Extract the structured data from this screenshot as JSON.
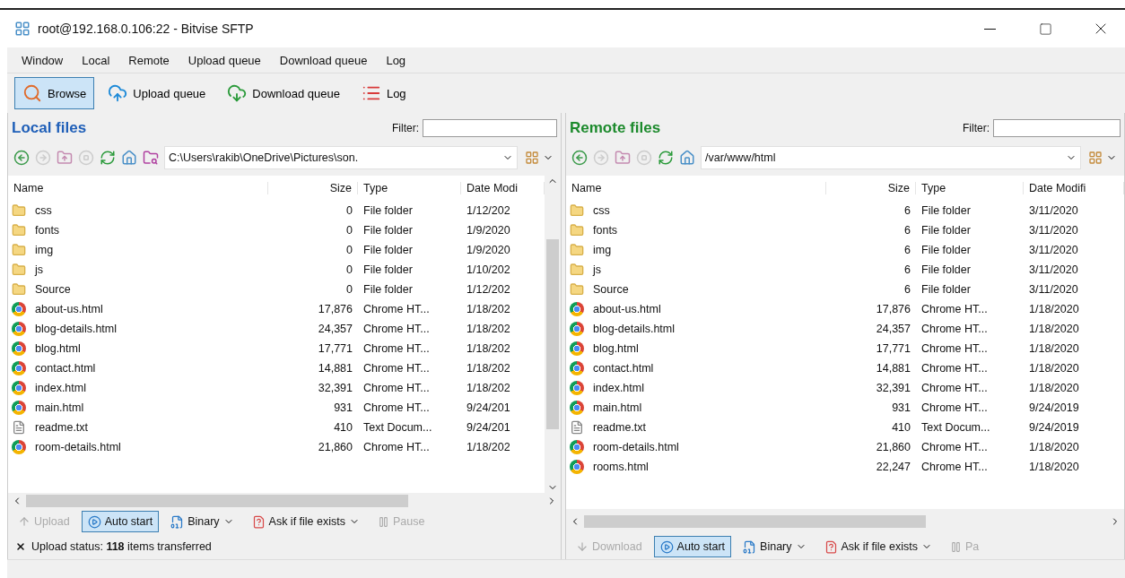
{
  "window": {
    "title": "root@192.168.0.106:22 - Bitvise SFTP"
  },
  "menu": [
    "Window",
    "Local",
    "Remote",
    "Upload queue",
    "Download queue",
    "Log"
  ],
  "toolbar": [
    {
      "label": "Browse",
      "kind": "browse",
      "selected": true
    },
    {
      "label": "Upload queue",
      "kind": "upload",
      "selected": false
    },
    {
      "label": "Download queue",
      "kind": "download",
      "selected": false
    },
    {
      "label": "Log",
      "kind": "log",
      "selected": false
    }
  ],
  "panes": [
    {
      "kind": "local",
      "title": "Local files",
      "color": "#1f5fb8",
      "filter_label": "Filter:",
      "path": "C:\\Users\\rakib\\OneDrive\\Pictures\\son.",
      "columns": [
        "Name",
        "Size",
        "Type",
        "Date Modi"
      ],
      "rows": [
        {
          "kind": "folder",
          "name": "css",
          "size": "0",
          "type": "File folder",
          "date": "1/12/202"
        },
        {
          "kind": "folder",
          "name": "fonts",
          "size": "0",
          "type": "File folder",
          "date": "1/9/2020"
        },
        {
          "kind": "folder",
          "name": "img",
          "size": "0",
          "type": "File folder",
          "date": "1/9/2020"
        },
        {
          "kind": "folder",
          "name": "js",
          "size": "0",
          "type": "File folder",
          "date": "1/10/202"
        },
        {
          "kind": "folder",
          "name": "Source",
          "size": "0",
          "type": "File folder",
          "date": "1/12/202"
        },
        {
          "kind": "html",
          "name": "about-us.html",
          "size": "17,876",
          "type": "Chrome HT...",
          "date": "1/18/202"
        },
        {
          "kind": "html",
          "name": "blog-details.html",
          "size": "24,357",
          "type": "Chrome HT...",
          "date": "1/18/202"
        },
        {
          "kind": "html",
          "name": "blog.html",
          "size": "17,771",
          "type": "Chrome HT...",
          "date": "1/18/202"
        },
        {
          "kind": "html",
          "name": "contact.html",
          "size": "14,881",
          "type": "Chrome HT...",
          "date": "1/18/202"
        },
        {
          "kind": "html",
          "name": "index.html",
          "size": "32,391",
          "type": "Chrome HT...",
          "date": "1/18/202"
        },
        {
          "kind": "html",
          "name": "main.html",
          "size": "931",
          "type": "Chrome HT...",
          "date": "9/24/201"
        },
        {
          "kind": "text",
          "name": "readme.txt",
          "size": "410",
          "type": "Text Docum...",
          "date": "9/24/201"
        },
        {
          "kind": "html",
          "name": "room-details.html",
          "size": "21,860",
          "type": "Chrome HT...",
          "date": "1/18/202"
        }
      ],
      "transfer": {
        "label": "Upload",
        "disabled": true
      },
      "auto_start": {
        "label": "Auto start",
        "selected": true
      },
      "mode": "Binary",
      "exists": "Ask if file exists",
      "pause": {
        "label": "Pause",
        "disabled": true
      },
      "status": "Upload status: **118** items transferred"
    },
    {
      "kind": "remote",
      "title": "Remote files",
      "color": "#1c8a2c",
      "filter_label": "Filter:",
      "path": "/var/www/html",
      "columns": [
        "Name",
        "Size",
        "Type",
        "Date Modifi"
      ],
      "rows": [
        {
          "kind": "folder",
          "name": "css",
          "size": "6",
          "type": "File folder",
          "date": "3/11/2020"
        },
        {
          "kind": "folder",
          "name": "fonts",
          "size": "6",
          "type": "File folder",
          "date": "3/11/2020"
        },
        {
          "kind": "folder",
          "name": "img",
          "size": "6",
          "type": "File folder",
          "date": "3/11/2020"
        },
        {
          "kind": "folder",
          "name": "js",
          "size": "6",
          "type": "File folder",
          "date": "3/11/2020"
        },
        {
          "kind": "folder",
          "name": "Source",
          "size": "6",
          "type": "File folder",
          "date": "3/11/2020"
        },
        {
          "kind": "html",
          "name": "about-us.html",
          "size": "17,876",
          "type": "Chrome HT...",
          "date": "1/18/2020"
        },
        {
          "kind": "html",
          "name": "blog-details.html",
          "size": "24,357",
          "type": "Chrome HT...",
          "date": "1/18/2020"
        },
        {
          "kind": "html",
          "name": "blog.html",
          "size": "17,771",
          "type": "Chrome HT...",
          "date": "1/18/2020"
        },
        {
          "kind": "html",
          "name": "contact.html",
          "size": "14,881",
          "type": "Chrome HT...",
          "date": "1/18/2020"
        },
        {
          "kind": "html",
          "name": "index.html",
          "size": "32,391",
          "type": "Chrome HT...",
          "date": "1/18/2020"
        },
        {
          "kind": "html",
          "name": "main.html",
          "size": "931",
          "type": "Chrome HT...",
          "date": "9/24/2019"
        },
        {
          "kind": "text",
          "name": "readme.txt",
          "size": "410",
          "type": "Text Docum...",
          "date": "9/24/2019"
        },
        {
          "kind": "html",
          "name": "room-details.html",
          "size": "21,860",
          "type": "Chrome HT...",
          "date": "1/18/2020"
        },
        {
          "kind": "html",
          "name": "rooms.html",
          "size": "22,247",
          "type": "Chrome HT...",
          "date": "1/18/2020"
        }
      ],
      "transfer": {
        "label": "Download",
        "disabled": true
      },
      "auto_start": {
        "label": "Auto start",
        "selected": true
      },
      "mode": "Binary",
      "exists": "Ask if file exists",
      "pause": {
        "label": "Pa",
        "disabled": true
      }
    }
  ]
}
